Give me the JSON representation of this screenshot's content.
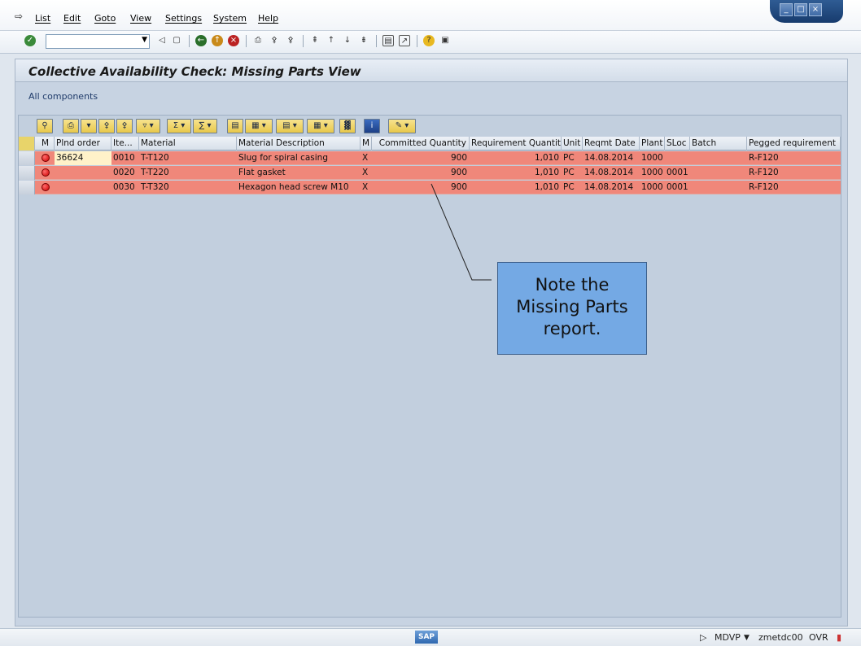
{
  "menu": [
    "List",
    "Edit",
    "Goto",
    "View",
    "Settings",
    "System",
    "Help"
  ],
  "command_field": {
    "value": ""
  },
  "screen": {
    "title": "Collective Availability Check: Missing Parts View",
    "subtitle": "All components"
  },
  "table": {
    "headers": [
      "M",
      "Plnd order",
      "Ite...",
      "Material",
      "Material Description",
      "M",
      "Committed Quantity",
      "Requirement Quantity",
      "Unit",
      "Reqmt Date",
      "Plant",
      "SLoc",
      "Batch",
      "Pegged requirement"
    ],
    "rows": [
      {
        "plnd_order": "36624",
        "item": "0010",
        "material": "T-T120",
        "description": "Slug for spiral casing",
        "m": "X",
        "committed": "900",
        "requirement": "1,010",
        "unit": "PC",
        "date": "14.08.2014",
        "plant": "1000",
        "sloc": "",
        "batch": "",
        "pegged": "R-F120"
      },
      {
        "plnd_order": "",
        "item": "0020",
        "material": "T-T220",
        "description": "Flat gasket",
        "m": "X",
        "committed": "900",
        "requirement": "1,010",
        "unit": "PC",
        "date": "14.08.2014",
        "plant": "1000",
        "sloc": "0001",
        "batch": "",
        "pegged": "R-F120"
      },
      {
        "plnd_order": "",
        "item": "0030",
        "material": "T-T320",
        "description": "Hexagon head screw M10",
        "m": "X",
        "committed": "900",
        "requirement": "1,010",
        "unit": "PC",
        "date": "14.08.2014",
        "plant": "1000",
        "sloc": "0001",
        "batch": "",
        "pegged": "R-F120"
      }
    ]
  },
  "callout": {
    "line1": "Note the",
    "line2": "Missing Parts",
    "line3": "report."
  },
  "status": {
    "system": "MDVP",
    "server": "zmetdc00",
    "mode": "OVR",
    "logo": "SAP"
  },
  "colors": {
    "missing_row": "#f0877a",
    "callout_bg": "#74a9e4"
  }
}
